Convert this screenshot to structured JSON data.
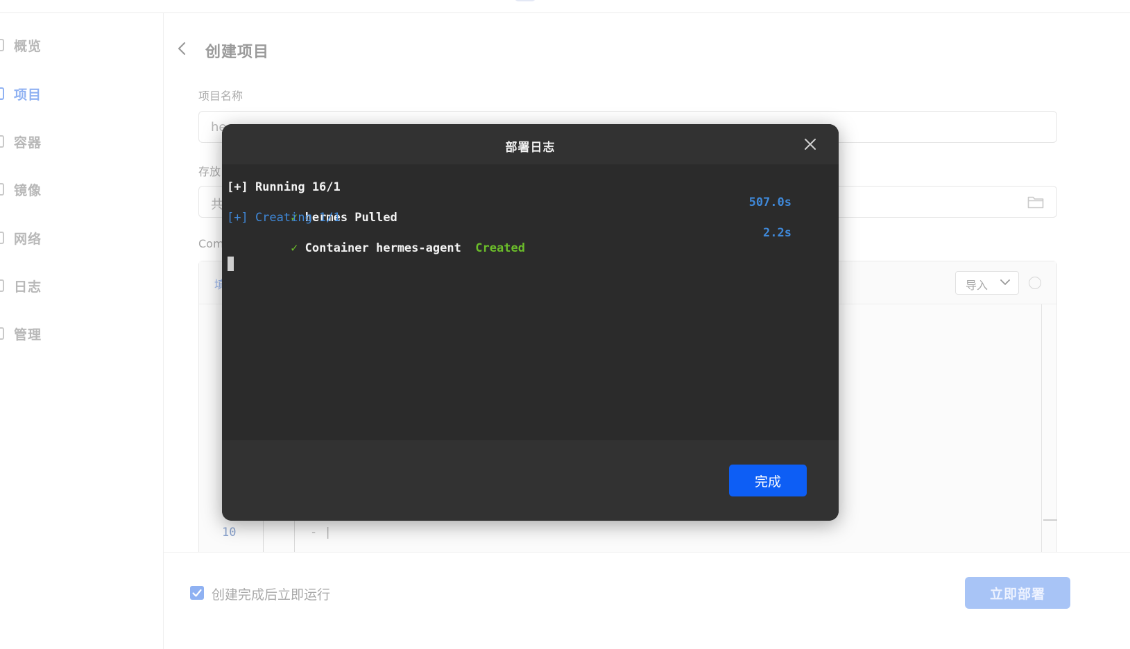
{
  "sidebar": {
    "items": [
      {
        "label": "概览",
        "icon": "overview-icon",
        "active": false
      },
      {
        "label": "项目",
        "icon": "project-icon",
        "active": true
      },
      {
        "label": "容器",
        "icon": "container-icon",
        "active": false
      },
      {
        "label": "镜像",
        "icon": "image-icon",
        "active": false
      },
      {
        "label": "网络",
        "icon": "network-icon",
        "active": false
      },
      {
        "label": "日志",
        "icon": "log-icon",
        "active": false
      },
      {
        "label": "管理",
        "icon": "manage-icon",
        "active": false
      }
    ]
  },
  "page": {
    "title": "创建项目",
    "project_name_label": "项目名称",
    "project_name_value": "he",
    "storage_label": "存放",
    "storage_value": "共",
    "compose_label": "Com",
    "compose_tab": "填",
    "import_label": "导入",
    "editor": {
      "line_number": "10",
      "line_text": "- |"
    }
  },
  "footer": {
    "auto_run_label": "创建完成后立即运行",
    "auto_run_checked": true,
    "deploy_label": "立即部署"
  },
  "modal": {
    "title": "部署日志",
    "log": {
      "line1": "[+] Running 16/1",
      "line2_check": "✓",
      "line2_text": "hermes Pulled",
      "line2_time": "507.0s",
      "line3": "[+] Creating 1/1",
      "line4_check": "✓",
      "line4_text": "Container hermes-agent",
      "line4_status": "Created",
      "line4_time": "2.2s"
    },
    "done_label": "完成"
  },
  "colors": {
    "accent": "#0d5ef5",
    "terminal_bg": "#2b2b2b",
    "log_blue": "#3f88d8",
    "log_green": "#6bbd2a"
  }
}
